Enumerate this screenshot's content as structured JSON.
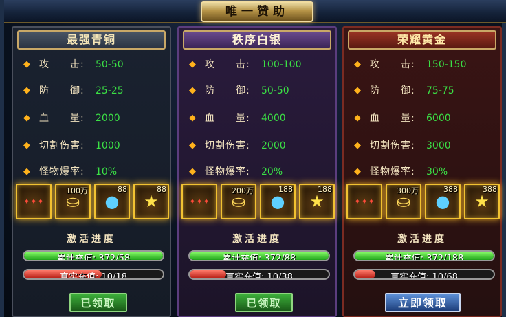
{
  "window": {
    "title": "唯一赞助"
  },
  "panels": [
    {
      "name": "最强青铜",
      "stats": [
        {
          "label": "攻　　击:",
          "value": "50-50"
        },
        {
          "label": "防　　御:",
          "value": "25-25"
        },
        {
          "label": "血　　量:",
          "value": "2000"
        },
        {
          "label": "切割伤害:",
          "value": "1000"
        },
        {
          "label": "怪物爆率:",
          "value": "10%"
        }
      ],
      "items": [
        {
          "icon": "title-badge-icon",
          "qty": ""
        },
        {
          "icon": "gold-ingot-icon",
          "qty": "100万"
        },
        {
          "icon": "crystal-orb-icon",
          "qty": "88"
        },
        {
          "icon": "golden-ball-icon",
          "qty": "88"
        }
      ],
      "progress_title": "激活进度",
      "recharge_total": {
        "text": "累计充值: 372/58",
        "fraction": 1.0
      },
      "recharge_real": {
        "text": "真实充值: 10/18",
        "fraction": 0.56
      },
      "button": "已领取"
    },
    {
      "name": "秩序白银",
      "stats": [
        {
          "label": "攻　　击:",
          "value": "100-100"
        },
        {
          "label": "防　　御:",
          "value": "50-50"
        },
        {
          "label": "血　　量:",
          "value": "4000"
        },
        {
          "label": "切割伤害:",
          "value": "2000"
        },
        {
          "label": "怪物爆率:",
          "value": "20%"
        }
      ],
      "items": [
        {
          "icon": "title-badge-icon",
          "qty": ""
        },
        {
          "icon": "gold-ingot-icon",
          "qty": "200万"
        },
        {
          "icon": "crystal-orb-icon",
          "qty": "188"
        },
        {
          "icon": "golden-ball-icon",
          "qty": "188"
        }
      ],
      "progress_title": "激活进度",
      "recharge_total": {
        "text": "累计充值: 372/88",
        "fraction": 1.0
      },
      "recharge_real": {
        "text": "真实充值: 10/38",
        "fraction": 0.26
      },
      "button": "已领取"
    },
    {
      "name": "荣耀黄金",
      "stats": [
        {
          "label": "攻　　击:",
          "value": "150-150"
        },
        {
          "label": "防　　御:",
          "value": "75-75"
        },
        {
          "label": "血　　量:",
          "value": "6000"
        },
        {
          "label": "切割伤害:",
          "value": "3000"
        },
        {
          "label": "怪物爆率:",
          "value": "30%"
        }
      ],
      "items": [
        {
          "icon": "title-badge-icon",
          "qty": ""
        },
        {
          "icon": "gold-ingot-icon",
          "qty": "300万"
        },
        {
          "icon": "crystal-orb-icon",
          "qty": "388"
        },
        {
          "icon": "golden-ball-icon",
          "qty": "388"
        }
      ],
      "progress_title": "激活进度",
      "recharge_total": {
        "text": "累计充值: 372/188",
        "fraction": 1.0
      },
      "recharge_real": {
        "text": "真实充值: 10/68",
        "fraction": 0.15
      },
      "button": "立即领取"
    }
  ],
  "colors": {
    "stat_value": "#3be045",
    "label": "#f2e3bf",
    "bronze_header": "#2b3443",
    "silver_header": "#3b2557",
    "gold_header": "#5a1a12"
  }
}
